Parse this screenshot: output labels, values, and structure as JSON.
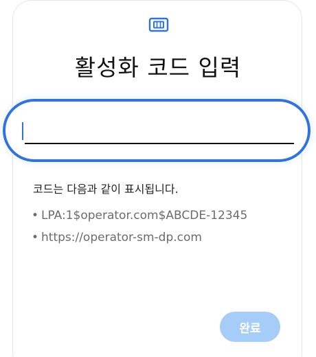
{
  "header": {
    "icon": "sim-card-icon",
    "title": "활성화 코드 입력"
  },
  "code_input": {
    "value": "",
    "placeholder": ""
  },
  "help": {
    "hint": "코드는 다음과 같이 표시됩니다.",
    "examples": [
      "LPA:1$operator.com$ABCDE-12345",
      "https://operator-sm-dp.com"
    ]
  },
  "actions": {
    "done_label": "완료",
    "done_enabled": false
  },
  "colors": {
    "accent": "#2f73e0",
    "button_disabled": "#a6cdf8",
    "text_primary": "#111111",
    "text_secondary": "#6b6b6b"
  }
}
